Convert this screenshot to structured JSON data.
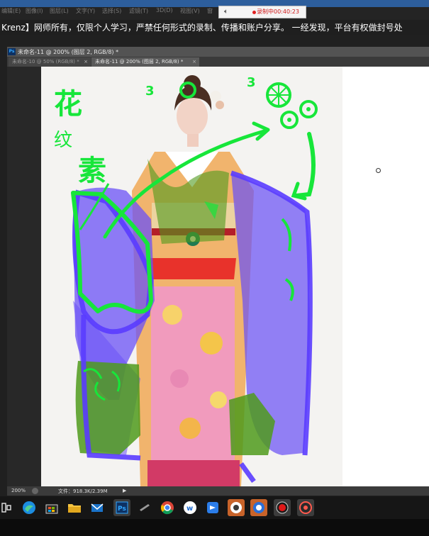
{
  "menubar": {
    "items": [
      "编辑(E)",
      "图像(I)",
      "图层(L)",
      "文字(Y)",
      "选择(S)",
      "滤镜(T)",
      "3D(D)",
      "视图(V)",
      "窗"
    ]
  },
  "recording": {
    "status": "录制中00:40:23"
  },
  "notice": {
    "text": "Krenz】网师所有，仅限个人学习，严禁任何形式的录制、传播和账户分享。 一经发现，平台有权做封号处"
  },
  "document": {
    "window_title": "未命名-11 @ 200% (图层 2, RGB/8) *",
    "tabs": [
      {
        "label": "未命名-10 @ 50% (RGB/8) *",
        "close": "×",
        "active": false
      },
      {
        "label": "未命名-11 @ 200% (图层 2, RGB/8) *",
        "close": "×",
        "active": true
      }
    ]
  },
  "sketch_annotations": {
    "hanzi_top": "花",
    "hanzi_mid": "纹",
    "hanzi_bottom": "素",
    "number_left": "3",
    "number_right": "3"
  },
  "statusbar": {
    "zoom": "200%",
    "file_info": "文件：918.3K/2.39M",
    "arrow": "▶"
  },
  "taskbar": {
    "items": [
      "task-view-icon",
      "edge-icon",
      "store-icon",
      "file-explorer-icon",
      "mail-icon",
      "photoshop-icon",
      "pen-tablet-icon",
      "chrome-icon",
      "wps-icon",
      "feishu-icon",
      "app-icon",
      "browser-icon",
      "record-icon",
      "obs-icon"
    ],
    "active_items": [
      "feishu-icon",
      "app-icon",
      "browser-icon",
      "record-icon",
      "obs-icon"
    ]
  },
  "colors": {
    "sketch_green": "#17e63a",
    "sketch_purple": "#5a3cff",
    "accent_blue": "#2d5e9c",
    "record_red": "#d01818"
  }
}
